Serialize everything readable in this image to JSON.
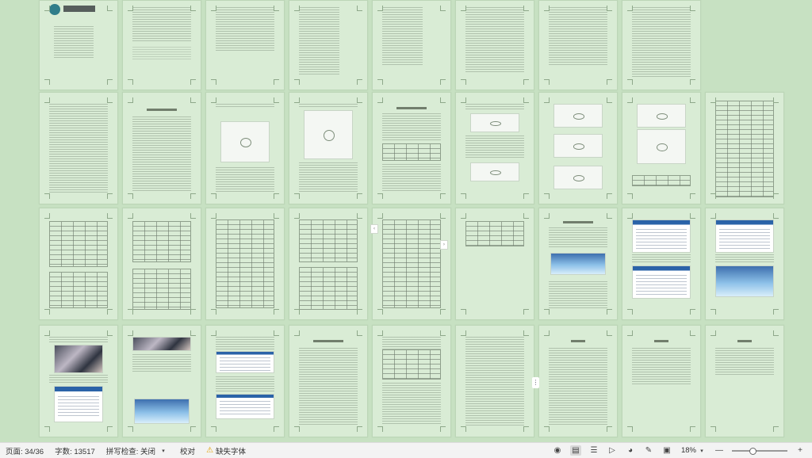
{
  "statusbar": {
    "page_label": "页面: 34/36",
    "word_count": "字数: 13517",
    "spellcheck": "拼写检查: 关闭",
    "proofread": "校对",
    "missing_fonts": "缺失字体",
    "zoom": "18%",
    "zoom_minus": "—",
    "zoom_plus": "+"
  },
  "icons": {
    "spellcheck_dropdown": "chevron-down-icon",
    "warning": "warning-icon",
    "eye": "eye-icon",
    "page_view": "page-view-icon",
    "outline": "outline-icon",
    "play": "play-icon",
    "web": "globe-icon",
    "pen": "pen-icon",
    "fit": "fit-page-icon",
    "zoom_dropdown": "chevron-down-icon"
  },
  "colors": {
    "canvas": "#c7e1c2",
    "page": "#d9ecd5",
    "statusbar": "#f3f3f3"
  }
}
